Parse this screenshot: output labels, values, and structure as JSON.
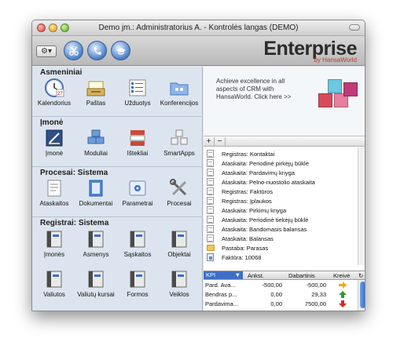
{
  "window": {
    "title": "Demo jm.: Administratorius A. - Kontrolės langas (DEMO)"
  },
  "toolbar": {
    "gear_label": "⚙▾"
  },
  "brand": {
    "name": "Enterprise",
    "sub": "by HansaWorld"
  },
  "sections": [
    {
      "title": "Asmeniniai",
      "items": [
        {
          "label": "Kalendorius",
          "icon": "calendar-icon"
        },
        {
          "label": "Paštas",
          "icon": "mail-tray-icon"
        },
        {
          "label": "Užduotys",
          "icon": "tasks-icon"
        },
        {
          "label": "Konferencijos",
          "icon": "conference-folder-icon"
        }
      ]
    },
    {
      "title": "Įmonė",
      "items": [
        {
          "label": "Įmonė",
          "icon": "company-icon"
        },
        {
          "label": "Moduliai",
          "icon": "modules-icon"
        },
        {
          "label": "Ištekliai",
          "icon": "resources-icon"
        },
        {
          "label": "SmartApps",
          "icon": "smartapps-icon"
        }
      ]
    },
    {
      "title": "Procesai: Sistema",
      "items": [
        {
          "label": "Ataskaitos",
          "icon": "reports-icon"
        },
        {
          "label": "Dokumentai",
          "icon": "documents-icon"
        },
        {
          "label": "Parametrai",
          "icon": "settings-icon"
        },
        {
          "label": "Procesai",
          "icon": "tools-icon"
        }
      ]
    },
    {
      "title": "Registrai: Sistema",
      "items": [
        {
          "label": "Įmonės",
          "icon": "register-icon"
        },
        {
          "label": "Asmenys",
          "icon": "register-icon"
        },
        {
          "label": "Sąskaitos",
          "icon": "register-icon"
        },
        {
          "label": "Objektai",
          "icon": "register-icon"
        },
        {
          "label": "Valiutos",
          "icon": "register-icon"
        },
        {
          "label": "Valiutų kursai",
          "icon": "register-icon"
        },
        {
          "label": "Formos",
          "icon": "register-icon"
        },
        {
          "label": "Veiklos",
          "icon": "register-icon"
        }
      ]
    }
  ],
  "promo": {
    "text": "Achieve excellence in all aspects of CRM with HansaWorld. Click here >>"
  },
  "plusminus": {
    "plus": "+",
    "minus": "−"
  },
  "tree": [
    {
      "label": "Registras: Kontaktai",
      "icon": "doc"
    },
    {
      "label": "Ataskaita: Periodinė pirkėjų būklė",
      "icon": "doc"
    },
    {
      "label": "Ataskaita: Pardavimų knyga",
      "icon": "doc"
    },
    {
      "label": "Ataskaita: Pelno-nuostolio ataskaita",
      "icon": "doc"
    },
    {
      "label": "Registras: Faktūros",
      "icon": "doc"
    },
    {
      "label": "Registras: Įplaukos",
      "icon": "doc"
    },
    {
      "label": "Ataskaita: Pirkimų knyga",
      "icon": "doc"
    },
    {
      "label": "Ataskaita: Periodinė tiekėjų būklė",
      "icon": "doc"
    },
    {
      "label": "Ataskaita: Bandomasis balansas",
      "icon": "doc"
    },
    {
      "label": "Ataskaita: Balansas",
      "icon": "doc"
    },
    {
      "label": "Pastaba: Parasas",
      "icon": "folder"
    },
    {
      "label": "Faktūra: 10068",
      "icon": "invoice"
    }
  ],
  "kpi": {
    "headers": {
      "kpi": "KPI",
      "anks": "Ankst.",
      "dabar": "Dabartinis",
      "kreive": "Kreivė"
    },
    "rows": [
      {
        "name": "Pard. Ava...",
        "anks": "-500,00",
        "dabar": "-500,00",
        "trend": "right",
        "color": "#f2a712"
      },
      {
        "name": "Bendras p...",
        "anks": "0,00",
        "dabar": "29,33",
        "trend": "up",
        "color": "#2e9b2e"
      },
      {
        "name": "Pardavima...",
        "anks": "0,00",
        "dabar": "7500,00",
        "trend": "down",
        "color": "#d6281e"
      }
    ]
  },
  "colors": {
    "accent": "#3f6fc4",
    "panel": "#dce5ef"
  }
}
